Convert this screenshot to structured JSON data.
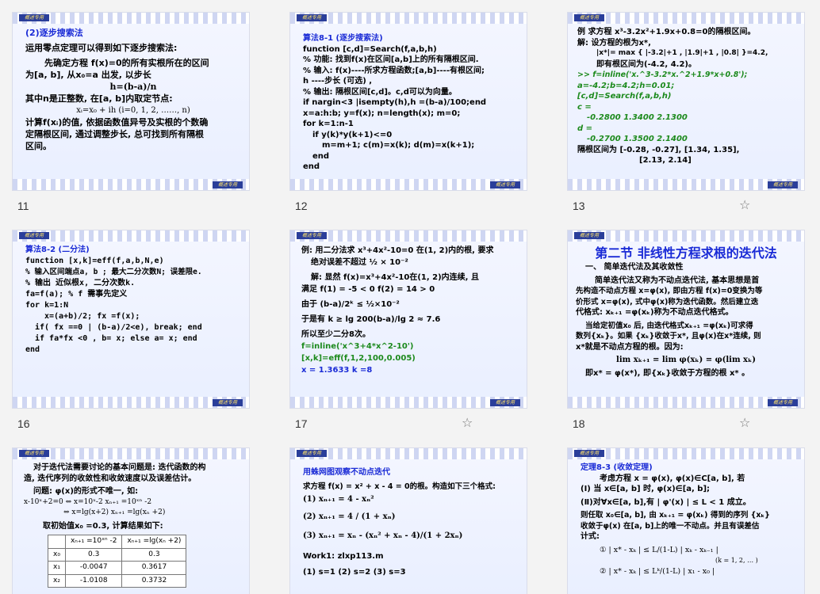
{
  "badge_text": "概述专用",
  "slides": [
    {
      "number": "11",
      "lines": [
        "(2)逐步搜索法",
        "运用零点定理可以得到如下逐步搜索法:",
        "先确定方程 f(x)=0的所有实根所在的区间",
        "为[a, b], 从x₀=a 出发, 以步长",
        "h=(b-a)/n",
        "其中n是正整数, 在[a, b]内取定节点:",
        "xᵢ=x₀ + ih      (i=0, 1, 2, ……, n)",
        "计算f(xᵢ)的值, 依据函数值异号及实根的个数确",
        "定隔根区间, 通过调整步长, 总可找到所有隔根",
        "区间。"
      ]
    },
    {
      "number": "12",
      "lines": [
        "算法8-1 (逐步搜索法)",
        "function [c,d]=Search(f,a,b,h)",
        "% 功能: 找到f(x)在区间[a,b]上的所有隔根区间.",
        "% 输入: f(x)----所求方程函数;[a,b]----有根区间;",
        "h ----步长 (可选) ,",
        "% 输出: 隔根区间[c,d]。c,d可以为向量。",
        "if nargin<3 |isempty(h),h =(b-a)/100;end",
        "x=a:h:b; y=f(x); n=length(x); m=0;",
        "for k=1:n-1",
        "if y(k)*y(k+1)<=0",
        "m=m+1; c(m)=x(k); d(m)=x(k+1);",
        "end",
        "end"
      ]
    },
    {
      "number": "13",
      "lines": [
        "例  求方程 x³-3.2x²+1.9x+0.8=0的隔根区间。",
        "解: 设方程的根为x*,",
        "|x*|= max { |-3.2|+1 , |1.9|+1 , |0.8| }=4.2,",
        "即有根区间为(-4.2, 4.2)。",
        ">> f=inline('x.^3-3.2*x.^2+1.9*x+0.8');",
        "a=-4.2;b=4.2;h=0.01;",
        "[c,d]=Search(f,a,b,h)",
        "c =",
        "-0.2800   1.3400   2.1300",
        "d =",
        "-0.2700   1.3500   2.1400",
        "隔根区间为    [-0.28, -0.27],     [1.34, 1.35],",
        "[2.13, 2.14]"
      ]
    },
    {
      "number": "16",
      "lines": [
        "算法8-2 (二分法)",
        "function [x,k]=eff(f,a,b,N,e)",
        "%  输入区间端点a, b ; 最大二分次数N; 误差限e.",
        "%  输出  近似根x, 二分次数k.",
        "fa=f(a);                        % f 需事先定义",
        "for  k=1:N",
        "x=(a+b)/2;  fx =f(x);",
        "if( fx ==0  |  (b-a)/2<e),  break;  end",
        "if   fa*fx <0 ,  b= x;  else  a= x;  end",
        "end"
      ]
    },
    {
      "number": "17",
      "lines": [
        "例: 用二分法求 x³+4x²-10=0 在(1, 2)内的根, 要求",
        "绝对误差不超过   ½ × 10⁻²",
        "解: 显然 f(x)=x³+4x²-10在(1, 2)内连续, 且",
        "满足    f(1) = -5 < 0        f(2) = 14 > 0",
        "由于      (b-a)/2ᵏ ≤ ½×10⁻²",
        "于是有      k ≥ lg 200(b-a)/lg 2 ≈ 7.6",
        "所以至少二分8次。",
        "f=inline('x^3+4*x^2-10')",
        "[x,k]=eff(f,1,2,100,0.005)",
        "x = 1.3633      k =8"
      ]
    },
    {
      "number": "18",
      "lines": [
        "第二节 非线性方程求根的迭代法",
        "一、  简单迭代法及其收敛性",
        "简单迭代法又称为不动点迭代法, 基本思想是首",
        "先构造不动点方程  x=φ(x), 即由方程  f(x)=0变换为等",
        "价形式  x=φ(x), 式中φ(x)称为迭代函数。然后建立迭",
        "代格式:  xₖ₊₁ =φ(xₖ)称为不动点迭代格式。",
        "当给定初值x₀ 后, 由迭代格式xₖ₊₁ =φ(xₖ)可求得",
        "数列{xₖ}。如果 {xₖ}收敛于x*, 且φ(x)在x*连续, 则",
        "x*就是不动点方程的根。因为:",
        "lim xₖ₊₁ = lim φ(xₖ) = φ(lim xₖ)",
        "即x* = φ(x*), 即{xₖ}收敛于方程的根 x* 。"
      ]
    },
    {
      "lines": [
        "对于迭代法需要讨论的基本问题是: 迭代函数的构",
        "造, 迭代序列的收敛性和收敛速度以及误差估计。",
        "问题:  φ(x)的形式不唯一, 如:",
        "x-10ˣ+2=0 ⇔ x=10ˣ-2      xₙ₊₁ =10ˣⁿ -2",
        "⇔ x=lg(x+2)       xₙ₊₁ =lg(xₙ +2)",
        "取初始值x₀ =0.3, 计算结果如下:"
      ],
      "table": {
        "headers": [
          "",
          "xₙ₊₁ =10ˣⁿ -2",
          "xₙ₊₁ =lg(xₙ +2)"
        ],
        "rows": [
          [
            "x₀",
            "0.3",
            "0.3"
          ],
          [
            "x₁",
            "-0.0047",
            "0.3617"
          ],
          [
            "x₂",
            "-1.0108",
            "0.3732"
          ]
        ]
      }
    },
    {
      "lines": [
        "用蛛网图观察不动点迭代",
        "求方程 f(x) = x² + x - 4 = 0的根。构造如下三个格式:",
        "(1)  xₙ₊₁ = 4 - xₙ²",
        "(2)  xₙ₊₁ = 4 / (1 + xₙ)",
        "(3)  xₙ₊₁ = xₙ - (xₙ² + xₙ - 4)/(1 + 2xₙ)",
        "Work1:   zlxp113.m",
        "(1)  s=1      (2) s=2      (3)   s=3"
      ]
    },
    {
      "lines": [
        "定理8-3 (收敛定理)",
        "考虑方程 x = φ(x),  φ(x)∈C[a, b], 若",
        "(Ⅰ) 当 x∈[a, b] 时,  φ(x)∈[a, b];",
        "(Ⅱ)对∀x∈[a, b],有 | φ'(x) | ≤ L < 1 成立。",
        "则任取 x₀∈[a, b],  由 xₖ₊₁ = φ(xₖ) 得到的序列  {xₖ}",
        "收敛于φ(x) 在[a, b]上的唯一不动点。并且有误差估",
        "计式:",
        "① | x* - xₖ | ≤ L/(1-L) | xₖ - xₖ₋₁ |",
        "(k = 1, 2, … )",
        "② | x* - xₖ | ≤ Lᵏ/(1-L) | x₁ - x₀ |"
      ]
    }
  ]
}
